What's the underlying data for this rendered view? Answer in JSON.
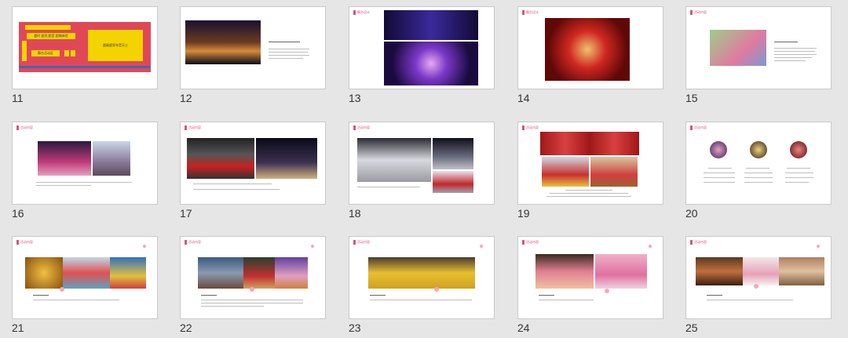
{
  "slides": [
    {
      "num": "11",
      "tag": ""
    },
    {
      "num": "12",
      "tag": ""
    },
    {
      "num": "13",
      "tag": "舞台设计"
    },
    {
      "num": "14",
      "tag": "舞台设计"
    },
    {
      "num": "15",
      "tag": "活动内容"
    },
    {
      "num": "16",
      "tag": "活动内容"
    },
    {
      "num": "17",
      "tag": "活动内容"
    },
    {
      "num": "18",
      "tag": "活动内容"
    },
    {
      "num": "19",
      "tag": "活动内容"
    },
    {
      "num": "20",
      "tag": "活动内容"
    },
    {
      "num": "21",
      "tag": "活动内容"
    },
    {
      "num": "22",
      "tag": "活动内容"
    },
    {
      "num": "23",
      "tag": "活动内容"
    },
    {
      "num": "24",
      "tag": "活动内容"
    },
    {
      "num": "25",
      "tag": "活动内容"
    }
  ],
  "slide11": {
    "center_text": "超级超亮车音天士",
    "left_text": "超时 超亮 超音 超嗨体验",
    "btn_label": "舞台活动区"
  },
  "colors": {
    "accent": "#e0507a",
    "bg": "#e6e6e6",
    "slide_bg": "#ffffff",
    "yellow": "#f4d400",
    "red": "#e04858"
  }
}
